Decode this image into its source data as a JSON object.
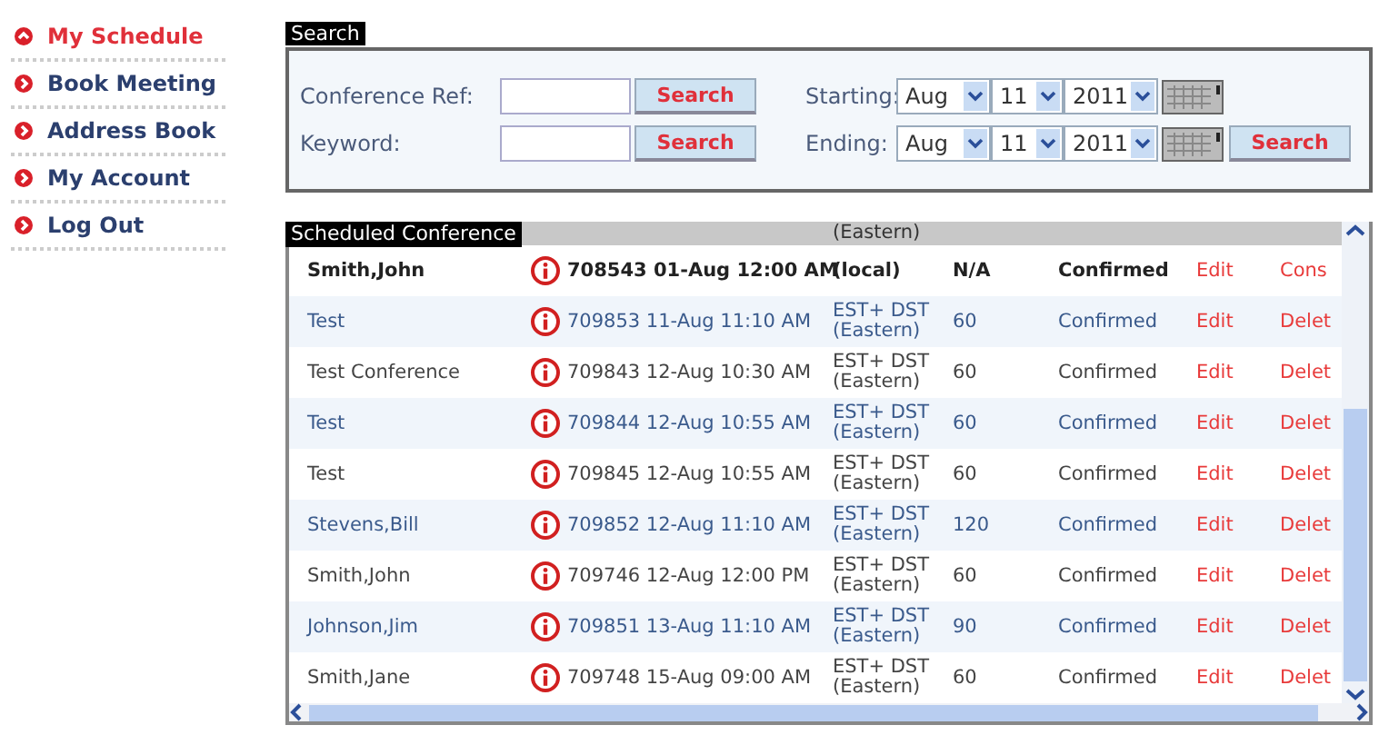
{
  "sidebar": {
    "items": [
      {
        "label": "My Schedule",
        "selected": true
      },
      {
        "label": "Book Meeting",
        "selected": false
      },
      {
        "label": "Address Book",
        "selected": false
      },
      {
        "label": "My Account",
        "selected": false
      },
      {
        "label": "Log Out",
        "selected": false
      }
    ]
  },
  "search": {
    "title": "Search",
    "fields": [
      {
        "label": "Conference Ref:",
        "button": "Search"
      },
      {
        "label": "Keyword:",
        "button": "Search"
      }
    ],
    "dates": [
      {
        "label": "Starting:",
        "month": "Aug",
        "day": "11",
        "year": "2011"
      },
      {
        "label": "Ending:",
        "month": "Aug",
        "day": "11",
        "year": "2011"
      }
    ],
    "button": "Search"
  },
  "schedule": {
    "title": "Scheduled Conference",
    "rows": [
      {
        "kind": "partial",
        "current": false,
        "timezone": "(Eastern)"
      },
      {
        "kind": "row",
        "current": true,
        "name": "Smith,John",
        "reference": "708543 01-Aug 12:00 AM",
        "timezone": "(local)",
        "duration": "N/A",
        "status": "Confirmed",
        "edit": "Edit",
        "action": "Cons"
      },
      {
        "kind": "row",
        "current": false,
        "name": "Test",
        "reference": "709853 11-Aug 11:10 AM",
        "timezone": "EST+ DST (Eastern)",
        "duration": "60",
        "status": "Confirmed",
        "edit": "Edit",
        "action": "Delet"
      },
      {
        "kind": "row",
        "current": false,
        "name": "Test Conference",
        "reference": "709843 12-Aug 10:30 AM",
        "timezone": "EST+ DST (Eastern)",
        "duration": "60",
        "status": "Confirmed",
        "edit": "Edit",
        "action": "Delet"
      },
      {
        "kind": "row",
        "current": false,
        "name": "Test",
        "reference": "709844 12-Aug 10:55 AM",
        "timezone": "EST+ DST (Eastern)",
        "duration": "60",
        "status": "Confirmed",
        "edit": "Edit",
        "action": "Delet"
      },
      {
        "kind": "row",
        "current": false,
        "name": "Test",
        "reference": "709845 12-Aug 10:55 AM",
        "timezone": "EST+ DST (Eastern)",
        "duration": "60",
        "status": "Confirmed",
        "edit": "Edit",
        "action": "Delet"
      },
      {
        "kind": "row",
        "current": false,
        "name": "Stevens,Bill",
        "reference": "709852 12-Aug 11:10 AM",
        "timezone": "EST+ DST (Eastern)",
        "duration": "120",
        "status": "Confirmed",
        "edit": "Edit",
        "action": "Delet"
      },
      {
        "kind": "row",
        "current": false,
        "name": "Smith,John",
        "reference": "709746 12-Aug 12:00 PM",
        "timezone": "EST+ DST (Eastern)",
        "duration": "60",
        "status": "Confirmed",
        "edit": "Edit",
        "action": "Delet"
      },
      {
        "kind": "row",
        "current": false,
        "name": "Johnson,Jim",
        "reference": "709851 13-Aug 11:10 AM",
        "timezone": "EST+ DST (Eastern)",
        "duration": "90",
        "status": "Confirmed",
        "edit": "Edit",
        "action": "Delet"
      },
      {
        "kind": "row",
        "current": false,
        "name": "Smith,Jane",
        "reference": "709748 15-Aug 09:00 AM",
        "timezone": "EST+ DST (Eastern)",
        "duration": "60",
        "status": "Confirmed",
        "edit": "Edit",
        "action": "Delet"
      }
    ]
  }
}
